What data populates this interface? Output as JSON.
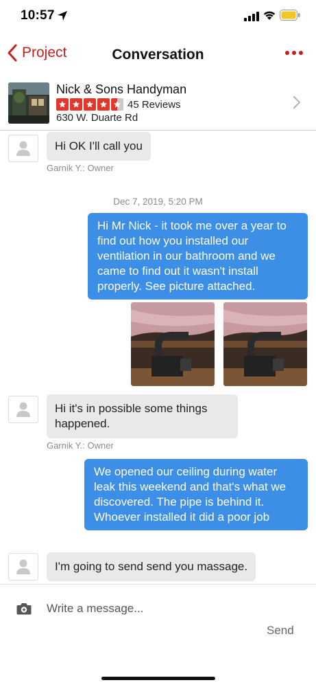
{
  "status_bar": {
    "time": "10:57"
  },
  "nav": {
    "back_label": "Project",
    "title": "Conversation"
  },
  "business": {
    "name": "Nick & Sons Handyman",
    "rating": 4.5,
    "reviews": "45 Reviews",
    "address": "630 W. Duarte Rd"
  },
  "messages": {
    "m1": {
      "text": "Hi OK I'll call you",
      "sender": "Garnik Y.: Owner"
    },
    "timestamp": "Dec 7, 2019, 5:20 PM",
    "m2": {
      "text": "Hi Mr Nick - it took me over a year to find out how you installed our ventilation in our bathroom and we came to find out it wasn't install properly.   See picture attached."
    },
    "m3": {
      "text": "Hi it's in possible some things happened.",
      "sender": "Garnik Y.: Owner"
    },
    "m4": {
      "text": "We opened our ceiling during water leak this weekend and that's what we discovered.   The pipe is behind it. Whoever installed it did a poor job"
    },
    "m5": {
      "text": "I'm going to send send you massage."
    }
  },
  "composer": {
    "placeholder": "Write a message...",
    "send_label": "Send"
  },
  "colors": {
    "accent": "#c4201d",
    "outgoing_bubble": "#3c8ee6",
    "incoming_bubble": "#e9e9e9",
    "star": "#e4362a"
  }
}
